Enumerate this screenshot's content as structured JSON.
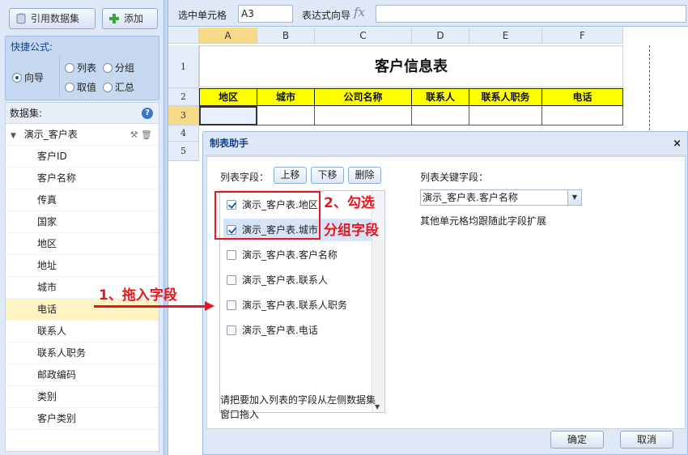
{
  "toolbar": {
    "dataset_btn": "引用数据集",
    "add_btn": "添加"
  },
  "quick_formula": {
    "title": "快捷公式:",
    "options": [
      "向导",
      "列表",
      "分组",
      "取值",
      "汇总"
    ],
    "selected": "向导"
  },
  "dataset_tree": {
    "title": "数据集:",
    "root": "演示_客户表",
    "fields": [
      "客户ID",
      "客户名称",
      "传真",
      "国家",
      "地区",
      "地址",
      "城市",
      "电话",
      "联系人",
      "联系人职务",
      "邮政编码",
      "类别",
      "客户类别"
    ],
    "highlighted": "电话"
  },
  "formula_bar": {
    "cell_label": "选中单元格",
    "cell_value": "A3",
    "expr_label": "表达式向导",
    "fx": "fx"
  },
  "sheet": {
    "columns": [
      "A",
      "B",
      "C",
      "D",
      "E",
      "F"
    ],
    "rows": [
      "1",
      "2",
      "3",
      "4",
      "5"
    ],
    "title": "客户信息表",
    "headers": [
      "地区",
      "城市",
      "公司名称",
      "联系人",
      "联系人职务",
      "电话"
    ]
  },
  "dialog": {
    "title": "制表助手",
    "close": "×",
    "list_fields_label": "列表字段：",
    "btn_up": "上移",
    "btn_down": "下移",
    "btn_delete": "删除",
    "list_items": [
      {
        "label": "演示_客户表.地区",
        "checked": true
      },
      {
        "label": "演示_客户表.城市",
        "checked": true
      },
      {
        "label": "演示_客户表.客户名称",
        "checked": false
      },
      {
        "label": "演示_客户表.联系人",
        "checked": false
      },
      {
        "label": "演示_客户表.联系人职务",
        "checked": false
      },
      {
        "label": "演示_客户表.电话",
        "checked": false
      }
    ],
    "key_field_label": "列表关键字段：",
    "key_field_value": "演示_客户表.客户名称",
    "key_hint": "其他单元格均跟随此字段扩展",
    "drag_hint_1": "请把要加入列表的字段从左侧数据集",
    "drag_hint_2": "窗口拖入",
    "ok": "确定",
    "cancel": "取消"
  },
  "annotations": {
    "step1": "1、拖入字段",
    "step2a": "2、勾选",
    "step2b": "分组字段"
  },
  "colors": {
    "header_fill": "#ffff00",
    "annotation_red": "#e8171c",
    "panel_blue": "#dfe8f6"
  }
}
